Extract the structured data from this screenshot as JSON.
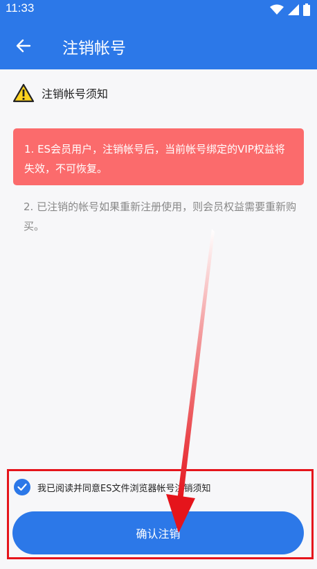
{
  "status_bar": {
    "time": "11:33",
    "icons": [
      "wifi-icon",
      "signal-icon",
      "battery-icon"
    ]
  },
  "toolbar": {
    "back_icon": "arrow-left-icon",
    "title": "注销帐号"
  },
  "notice": {
    "icon": "warning-icon",
    "heading": "注销帐号须知",
    "item1": "1. ES会员用户，注销帐号后，当前帐号绑定的VIP权益将失效，不可恢复。",
    "item2": "2. 已注销的帐号如果重新注册使用，则会员权益需要重新购买。"
  },
  "agreement": {
    "checked": true,
    "text": "我已阅读并同意ES文件浏览器帐号注销须知"
  },
  "confirm_button": {
    "label": "确认注销"
  },
  "colors": {
    "primary": "#2c78e8",
    "warning_bg": "#fb6b6c",
    "annotation_red": "#e5141b"
  }
}
